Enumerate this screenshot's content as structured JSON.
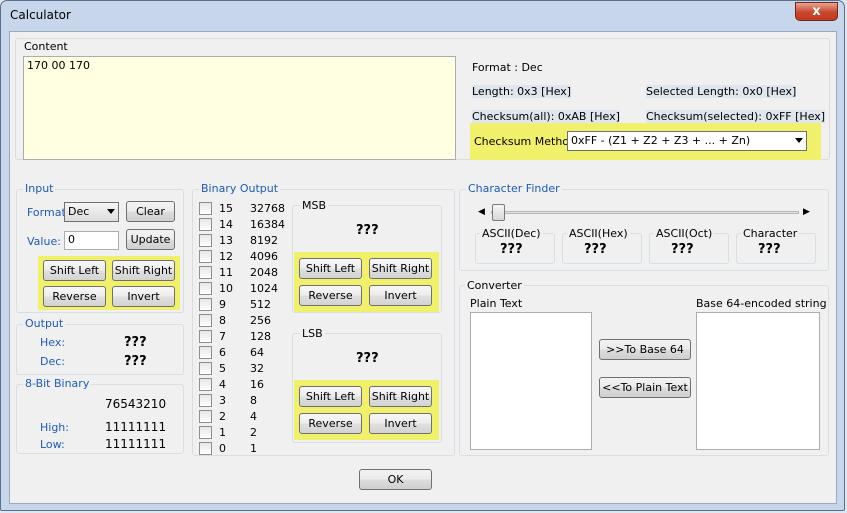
{
  "window": {
    "title": "Calculator",
    "close": "x"
  },
  "content": {
    "label": "Content",
    "value": "170 00 170",
    "format": "Format : Dec",
    "length": "Length:  0x3 [Hex]",
    "selected_length": "Selected Length:  0x0 [Hex]",
    "checksum_all": "Checksum(all):  0xAB [Hex]",
    "checksum_selected": "Checksum(selected):  0xFF [Hex]",
    "checksum_method_label": "Checksum Method:",
    "checksum_method_value": "0xFF - (Z1 + Z2 + Z3 + ... + Zn)"
  },
  "input": {
    "title": "Input",
    "format_label": "Format:",
    "format_value": "Dec",
    "clear": "Clear",
    "value_label": "Value:",
    "value": "0",
    "update": "Update",
    "shift_left": "Shift Left",
    "shift_right": "Shift Right",
    "reverse": "Reverse",
    "invert": "Invert"
  },
  "output": {
    "title": "Output",
    "hex_label": "Hex:",
    "hex_value": "???",
    "dec_label": "Dec:",
    "dec_value": "???"
  },
  "eight_bit": {
    "title": "8-Bit Binary",
    "header": "76543210",
    "high_label": "High:",
    "high_value": "11111111",
    "low_label": "Low:",
    "low_value": "11111111"
  },
  "binary_output": {
    "title": "Binary Output",
    "bits": [
      {
        "num": "15",
        "val": "32768"
      },
      {
        "num": "14",
        "val": "16384"
      },
      {
        "num": "13",
        "val": "8192"
      },
      {
        "num": "12",
        "val": "4096"
      },
      {
        "num": "11",
        "val": "2048"
      },
      {
        "num": "10",
        "val": "1024"
      },
      {
        "num": "9",
        "val": "512"
      },
      {
        "num": "8",
        "val": "256"
      },
      {
        "num": "7",
        "val": "128"
      },
      {
        "num": "6",
        "val": "64"
      },
      {
        "num": "5",
        "val": "32"
      },
      {
        "num": "4",
        "val": "16"
      },
      {
        "num": "3",
        "val": "8"
      },
      {
        "num": "2",
        "val": "4"
      },
      {
        "num": "1",
        "val": "2"
      },
      {
        "num": "0",
        "val": "1"
      }
    ],
    "msb": {
      "title": "MSB",
      "value": "???",
      "shift_left": "Shift Left",
      "shift_right": "Shift Right",
      "reverse": "Reverse",
      "invert": "Invert"
    },
    "lsb": {
      "title": "LSB",
      "value": "???",
      "shift_left": "Shift Left",
      "shift_right": "Shift Right",
      "reverse": "Reverse",
      "invert": "Invert"
    }
  },
  "character_finder": {
    "title": "Character Finder",
    "ascii_dec_label": "ASCII(Dec)",
    "ascii_dec_value": "???",
    "ascii_hex_label": "ASCII(Hex)",
    "ascii_hex_value": "???",
    "ascii_oct_label": "ASCII(Oct)",
    "ascii_oct_value": "???",
    "character_label": "Character",
    "character_value": "???"
  },
  "converter": {
    "title": "Converter",
    "plain_text_label": "Plain Text",
    "base64_label": "Base 64-encoded string",
    "to_base64": ">>To Base 64",
    "to_plain": "<<To Plain Text"
  },
  "footer": {
    "ok": "OK"
  },
  "colors": {
    "highlight": "#f1f06a",
    "group_title": "#1e5bb5",
    "content_bg": "#ffffe1"
  }
}
